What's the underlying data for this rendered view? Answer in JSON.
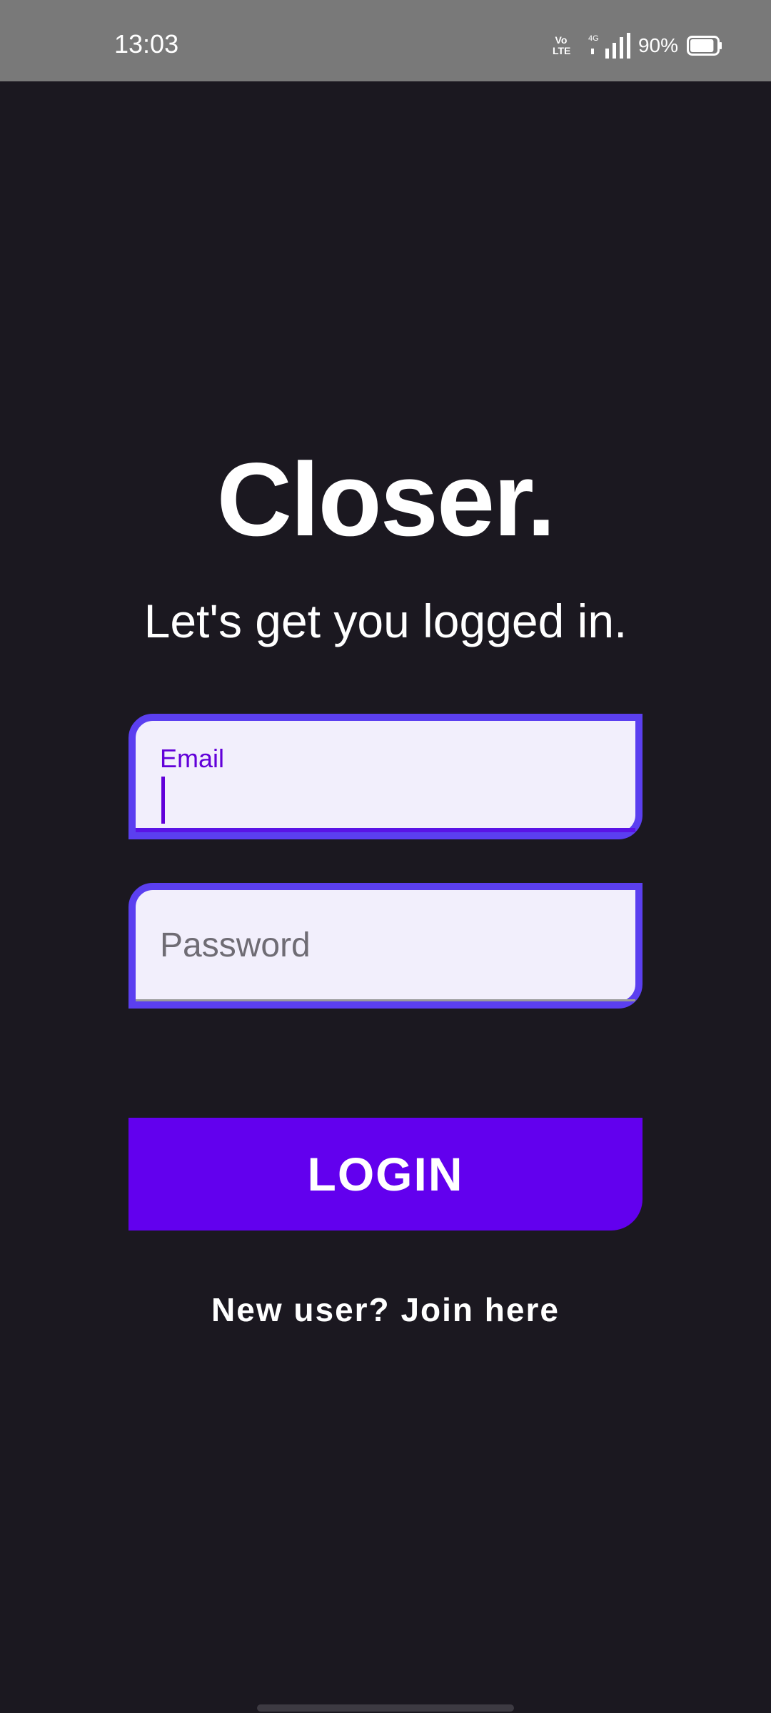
{
  "status_bar": {
    "time": "13:03",
    "volte_line1": "Vo",
    "volte_line2": "LTE",
    "network": "4G",
    "battery_percent": "90%",
    "battery_level": 0.9,
    "icons": [
      "volte-icon",
      "signal-icon",
      "battery-icon"
    ]
  },
  "app": {
    "title": "Closer.",
    "subtitle": "Let's get you logged in."
  },
  "form": {
    "email": {
      "label": "Email",
      "value": ""
    },
    "password": {
      "placeholder": "Password",
      "value": ""
    },
    "login_label": "LOGIN",
    "join_text": "New user? Join here"
  },
  "colors": {
    "background": "#1b1820",
    "status_bar": "#797979",
    "accent": "#6200ee",
    "field_border": "#5b3ff0",
    "field_fill": "#f2effc",
    "label": "#6200d9"
  }
}
